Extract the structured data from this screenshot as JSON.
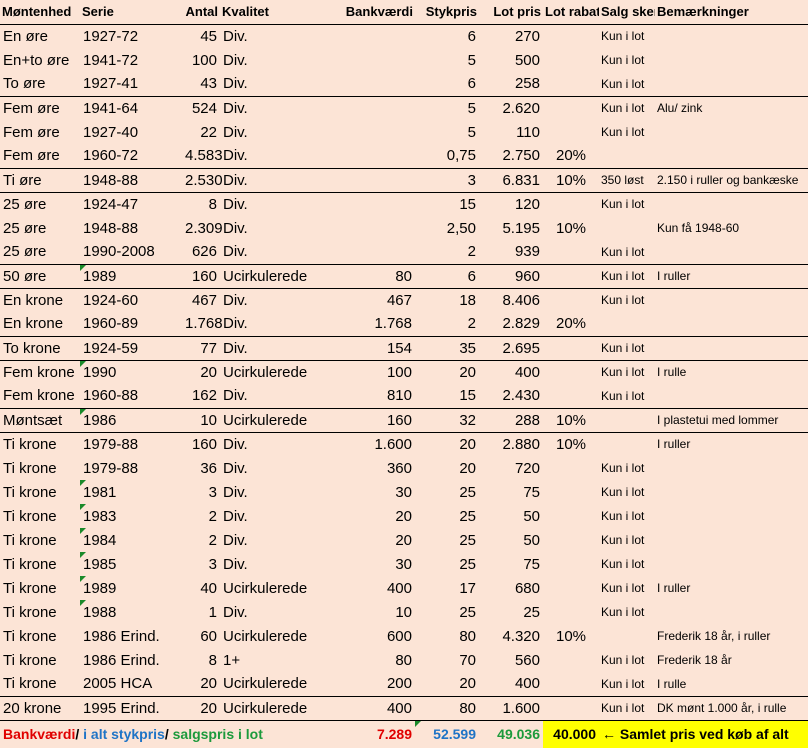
{
  "headers": [
    "Møntenhed",
    "Serie",
    "Antal",
    "Kvalitet",
    "Bankværdi",
    "Stykpris",
    "Lot pris",
    "Lot rabat",
    "Salg sker",
    "Bemærkninger"
  ],
  "rows": [
    {
      "enhed": "En øre",
      "serie": "1927-72",
      "antal": "45",
      "kvalitet": "Div.",
      "bank": "",
      "styk": "6",
      "lot": "270",
      "rabat": "",
      "salg": "Kun i lot",
      "bem": "",
      "sep": true,
      "tri": false
    },
    {
      "enhed": "En+to øre",
      "serie": "1941-72",
      "antal": "100",
      "kvalitet": "Div.",
      "bank": "",
      "styk": "5",
      "lot": "500",
      "rabat": "",
      "salg": "Kun i lot",
      "bem": "",
      "sep": false,
      "tri": false
    },
    {
      "enhed": "To øre",
      "serie": "1927-41",
      "antal": "43",
      "kvalitet": "Div.",
      "bank": "",
      "styk": "6",
      "lot": "258",
      "rabat": "",
      "salg": "Kun i lot",
      "bem": "",
      "sep": false,
      "tri": false
    },
    {
      "enhed": "Fem øre",
      "serie": "1941-64",
      "antal": "524",
      "kvalitet": "Div.",
      "bank": "",
      "styk": "5",
      "lot": "2.620",
      "rabat": "",
      "salg": "Kun i lot",
      "bem": "Alu/ zink",
      "sep": true,
      "tri": false
    },
    {
      "enhed": "Fem øre",
      "serie": "1927-40",
      "antal": "22",
      "kvalitet": "Div.",
      "bank": "",
      "styk": "5",
      "lot": "110",
      "rabat": "",
      "salg": "Kun i lot",
      "bem": "",
      "sep": false,
      "tri": false
    },
    {
      "enhed": "Fem øre",
      "serie": "1960-72",
      "antal": "4.583",
      "kvalitet": "Div.",
      "bank": "",
      "styk": "0,75",
      "lot": "2.750",
      "rabat": "20%",
      "salg": "",
      "bem": "",
      "sep": false,
      "tri": false
    },
    {
      "enhed": "Ti øre",
      "serie": "1948-88",
      "antal": "2.530",
      "kvalitet": "Div.",
      "bank": "",
      "styk": "3",
      "lot": "6.831",
      "rabat": "10%",
      "salg": "350 løst",
      "bem": "2.150 i ruller og bankæske",
      "sep": true,
      "tri": false
    },
    {
      "enhed": "25 øre",
      "serie": "1924-47",
      "antal": "8",
      "kvalitet": "Div.",
      "bank": "",
      "styk": "15",
      "lot": "120",
      "rabat": "",
      "salg": "Kun i lot",
      "bem": "",
      "sep": true,
      "tri": false
    },
    {
      "enhed": "25 øre",
      "serie": "1948-88",
      "antal": "2.309",
      "kvalitet": "Div.",
      "bank": "",
      "styk": "2,50",
      "lot": "5.195",
      "rabat": "10%",
      "salg": "",
      "bem": "Kun få 1948-60",
      "sep": false,
      "tri": false
    },
    {
      "enhed": "25 øre",
      "serie": "1990-2008",
      "antal": "626",
      "kvalitet": "Div.",
      "bank": "",
      "styk": "2",
      "lot": "939",
      "rabat": "",
      "salg": "Kun i lot",
      "bem": "",
      "sep": false,
      "tri": false
    },
    {
      "enhed": "50 øre",
      "serie": "1989",
      "antal": "160",
      "kvalitet": "Ucirkulerede",
      "bank": "80",
      "styk": "6",
      "lot": "960",
      "rabat": "",
      "salg": "Kun i lot",
      "bem": "I ruller",
      "sep": true,
      "tri": true
    },
    {
      "enhed": "En krone",
      "serie": "1924-60",
      "antal": "467",
      "kvalitet": "Div.",
      "bank": "467",
      "styk": "18",
      "lot": "8.406",
      "rabat": "",
      "salg": "Kun i lot",
      "bem": "",
      "sep": true,
      "tri": false
    },
    {
      "enhed": "En krone",
      "serie": "1960-89",
      "antal": "1.768",
      "kvalitet": "Div.",
      "bank": "1.768",
      "styk": "2",
      "lot": "2.829",
      "rabat": "20%",
      "salg": "",
      "bem": "",
      "sep": false,
      "tri": false
    },
    {
      "enhed": "To krone",
      "serie": "1924-59",
      "antal": "77",
      "kvalitet": "Div.",
      "bank": "154",
      "styk": "35",
      "lot": "2.695",
      "rabat": "",
      "salg": "Kun i lot",
      "bem": "",
      "sep": true,
      "tri": false
    },
    {
      "enhed": "Fem krone",
      "serie": "1990",
      "antal": "20",
      "kvalitet": "Ucirkulerede",
      "bank": "100",
      "styk": "20",
      "lot": "400",
      "rabat": "",
      "salg": "Kun i lot",
      "bem": "I rulle",
      "sep": true,
      "tri": true
    },
    {
      "enhed": "Fem krone",
      "serie": "1960-88",
      "antal": "162",
      "kvalitet": "Div.",
      "bank": "810",
      "styk": "15",
      "lot": "2.430",
      "rabat": "",
      "salg": "Kun i lot",
      "bem": "",
      "sep": false,
      "tri": false
    },
    {
      "enhed": "Møntsæt",
      "serie": "1986",
      "antal": "10",
      "kvalitet": "Ucirkulerede",
      "bank": "160",
      "styk": "32",
      "lot": "288",
      "rabat": "10%",
      "salg": "",
      "bem": "I plastetui med lommer",
      "sep": true,
      "tri": true
    },
    {
      "enhed": "Ti krone",
      "serie": "1979-88",
      "antal": "160",
      "kvalitet": "Div.",
      "bank": "1.600",
      "styk": "20",
      "lot": "2.880",
      "rabat": "10%",
      "salg": "",
      "bem": "I ruller",
      "sep": true,
      "tri": false
    },
    {
      "enhed": "Ti krone",
      "serie": "1979-88",
      "antal": "36",
      "kvalitet": "Div.",
      "bank": "360",
      "styk": "20",
      "lot": "720",
      "rabat": "",
      "salg": "Kun i lot",
      "bem": "",
      "sep": false,
      "tri": false
    },
    {
      "enhed": "Ti krone",
      "serie": "1981",
      "antal": "3",
      "kvalitet": "Div.",
      "bank": "30",
      "styk": "25",
      "lot": "75",
      "rabat": "",
      "salg": "Kun i lot",
      "bem": "",
      "sep": false,
      "tri": true
    },
    {
      "enhed": "Ti krone",
      "serie": "1983",
      "antal": "2",
      "kvalitet": "Div.",
      "bank": "20",
      "styk": "25",
      "lot": "50",
      "rabat": "",
      "salg": "Kun i lot",
      "bem": "",
      "sep": false,
      "tri": true
    },
    {
      "enhed": "Ti krone",
      "serie": "1984",
      "antal": "2",
      "kvalitet": "Div.",
      "bank": "20",
      "styk": "25",
      "lot": "50",
      "rabat": "",
      "salg": "Kun i lot",
      "bem": "",
      "sep": false,
      "tri": true
    },
    {
      "enhed": "Ti krone",
      "serie": "1985",
      "antal": "3",
      "kvalitet": "Div.",
      "bank": "30",
      "styk": "25",
      "lot": "75",
      "rabat": "",
      "salg": "Kun i lot",
      "bem": "",
      "sep": false,
      "tri": true
    },
    {
      "enhed": "Ti krone",
      "serie": "1989",
      "antal": "40",
      "kvalitet": "Ucirkulerede",
      "bank": "400",
      "styk": "17",
      "lot": "680",
      "rabat": "",
      "salg": "Kun i lot",
      "bem": "I ruller",
      "sep": false,
      "tri": true
    },
    {
      "enhed": "Ti krone",
      "serie": "1988",
      "antal": "1",
      "kvalitet": "Div.",
      "bank": "10",
      "styk": "25",
      "lot": "25",
      "rabat": "",
      "salg": "Kun i lot",
      "bem": "",
      "sep": false,
      "tri": true
    },
    {
      "enhed": "Ti krone",
      "serie": "1986 Erind.",
      "antal": "60",
      "kvalitet": "Ucirkulerede",
      "bank": "600",
      "styk": "80",
      "lot": "4.320",
      "rabat": "10%",
      "salg": "",
      "bem": "Frederik 18 år, i ruller",
      "sep": false,
      "tri": false
    },
    {
      "enhed": "Ti krone",
      "serie": "1986 Erind.",
      "antal": "8",
      "kvalitet": "1+",
      "bank": "80",
      "styk": "70",
      "lot": "560",
      "rabat": "",
      "salg": "Kun i lot",
      "bem": "Frederik 18 år",
      "sep": false,
      "tri": false
    },
    {
      "enhed": "Ti krone",
      "serie": "2005 HCA",
      "antal": "20",
      "kvalitet": "Ucirkulerede",
      "bank": "200",
      "styk": "20",
      "lot": "400",
      "rabat": "",
      "salg": "Kun i lot",
      "bem": "I rulle",
      "sep": false,
      "tri": false
    },
    {
      "enhed": "20 krone",
      "serie": "1995 Erind.",
      "antal": "20",
      "kvalitet": "Ucirkulerede",
      "bank": "400",
      "styk": "80",
      "lot": "1.600",
      "rabat": "",
      "salg": "Kun i lot",
      "bem": "DK mønt 1.000 år, i rulle",
      "sep": true,
      "tri": false
    }
  ],
  "totals": {
    "label_bank": "Bankværdi",
    "label_sep1": "/ ",
    "label_styk": "i alt stykpris",
    "label_sep2": "/ ",
    "label_salg": "salgspris i lot",
    "bank": "7.289",
    "styk": "52.599",
    "lot": "49.036",
    "samlet": "40.000",
    "samlet_label": "← Samlet pris ved køb af alt"
  },
  "colors": {
    "background": "#fce4d6",
    "red": "#e00000",
    "blue": "#1f74c6",
    "green": "#1c9a3c",
    "highlight": "#ffff00"
  }
}
